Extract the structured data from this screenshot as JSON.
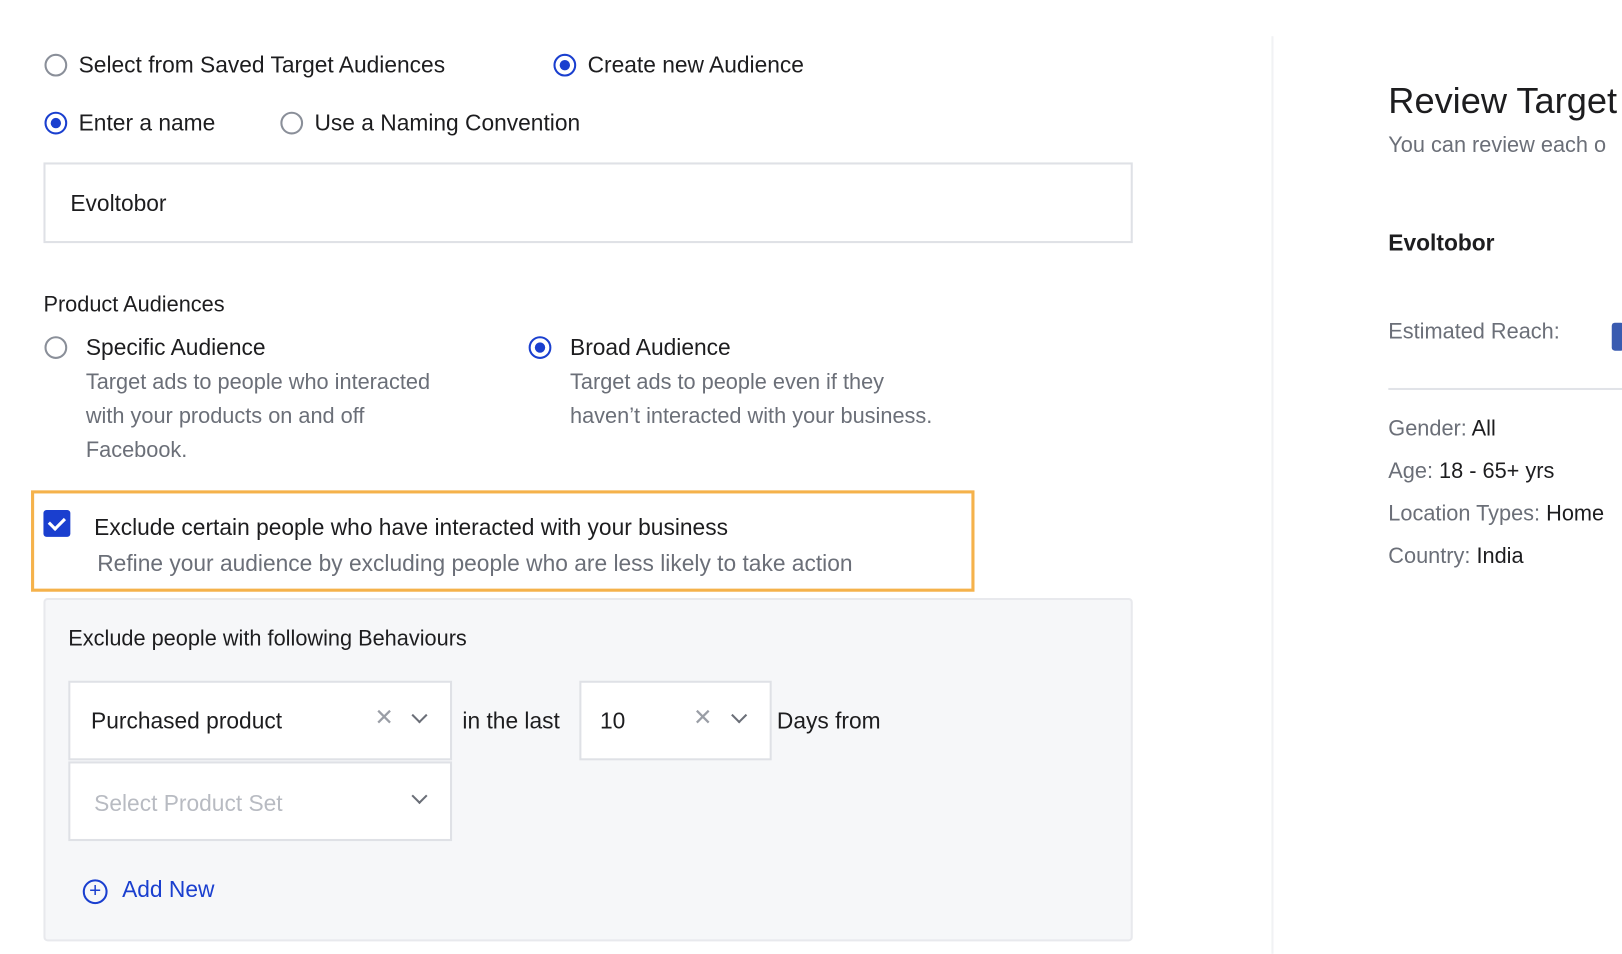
{
  "audience_source": {
    "options": [
      {
        "label": "Select from Saved Target Audiences",
        "selected": false
      },
      {
        "label": "Create new Audience",
        "selected": true
      }
    ]
  },
  "naming": {
    "options": [
      {
        "label": "Enter a name",
        "selected": true
      },
      {
        "label": "Use a Naming Convention",
        "selected": false
      }
    ],
    "name_value": "Evoltobor"
  },
  "product_audiences": {
    "title": "Product Audiences",
    "options": [
      {
        "label": "Specific Audience",
        "description": [
          "Target ads to people who interacted",
          "with your products on and off",
          "Facebook."
        ],
        "selected": false
      },
      {
        "label": "Broad Audience",
        "description": [
          "Target ads to people even if they",
          "haven’t interacted with your business."
        ],
        "selected": true
      }
    ]
  },
  "exclude": {
    "checked": true,
    "label": "Exclude certain people who have interacted with your business",
    "description": "Refine your audience by excluding people who are less likely to take action",
    "highlight_color": "#f5b24b"
  },
  "behaviours": {
    "title": "Exclude people with following Behaviours",
    "behaviour_value": "Purchased product",
    "in_the_last": "in the last",
    "days_value": "10",
    "days_from": "Days from",
    "product_set_placeholder": "Select Product Set",
    "add_new": "Add New"
  },
  "review": {
    "title": "Review Target",
    "subtitle": "You can review each o",
    "audience_name": "Evoltobor",
    "estimated_reach_label": "Estimated Reach:",
    "details": [
      {
        "label": "Gender:",
        "value": "All"
      },
      {
        "label": "Age:",
        "value": "18 - 65+ yrs"
      },
      {
        "label": "Location Types:",
        "value": "Home"
      },
      {
        "label": "Country:",
        "value": "India"
      }
    ]
  },
  "colors": {
    "accent": "#1a3fcf",
    "highlight": "#f5b24b"
  }
}
